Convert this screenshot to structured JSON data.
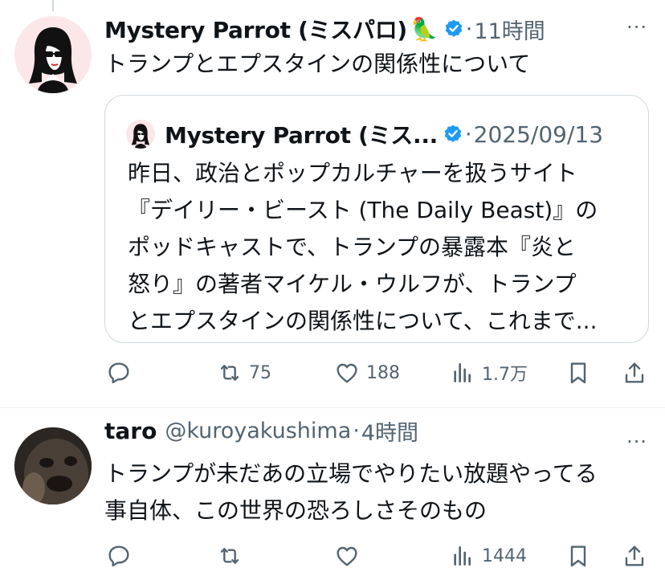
{
  "tweets": [
    {
      "author_name": "Mystery Parrot (ミスパロ)",
      "author_emoji": "🦜",
      "time": "11時間",
      "text": "トランプとエプスタインの関係性について",
      "quote": {
        "author_name": "Mystery Parrot (ミス...",
        "date": "2025/09/13",
        "lines": [
          "昨日、政治とポップカルチャーを扱うサイト",
          "『デイリー・ビースト (The Daily Beast)』の",
          "ポッドキャストで、トランプの暴露本『炎と",
          "怒り』の著者マイケル・ウルフが、トランプ",
          "とエプスタインの関係性について、これまで..."
        ]
      },
      "actions": {
        "reply_count": "",
        "retweet_count": "75",
        "like_count": "188",
        "views_count": "1.7万"
      }
    },
    {
      "author_name": "taro",
      "handle": "@kuroyakushima",
      "time": "4時間",
      "text_lines": [
        "トランプが未だあの立場でやりたい放題やってる",
        "事自体、この世界の恐ろしさそのもの"
      ],
      "actions": {
        "reply_count": "",
        "retweet_count": "",
        "like_count": "",
        "views_count": "1444"
      }
    }
  ],
  "ui": {
    "dot_separator": "·",
    "more_glyph": "···"
  },
  "colors": {
    "verified": "#1d9bf0",
    "secondary_text": "#536471",
    "border": "#cfd9de"
  }
}
